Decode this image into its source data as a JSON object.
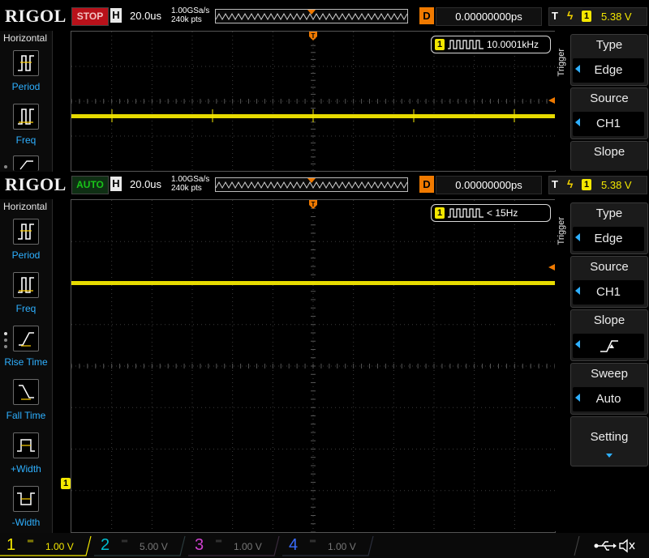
{
  "screens": [
    {
      "id": "top",
      "brand": "RIGOL",
      "run_state": "STOP",
      "timebase_label": "H",
      "timebase_value": "20.0us",
      "sample_rate": "1.00GSa/s",
      "memory_depth": "240k pts",
      "delay_label": "D",
      "delay_value": "0.00000000ps",
      "trigger_label": "T",
      "trigger_channel": "1",
      "trigger_level": "5.38 V",
      "freq_channel": "1",
      "freq_value": "10.0001kHz",
      "menu_heading": "Horizontal",
      "left_buttons": [
        {
          "label": "Period",
          "icon": "period-icon"
        },
        {
          "label": "Freq",
          "icon": "freq-icon"
        }
      ],
      "right_caption": "Trigger",
      "right_buttons": [
        {
          "title": "Type",
          "value": "Edge"
        },
        {
          "title": "Source",
          "value": "CH1"
        },
        {
          "title": "Slope",
          "value": ""
        }
      ]
    },
    {
      "id": "bottom",
      "brand": "RIGOL",
      "run_state": "AUTO",
      "timebase_label": "H",
      "timebase_value": "20.0us",
      "sample_rate": "1.00GSa/s",
      "memory_depth": "240k pts",
      "delay_label": "D",
      "delay_value": "0.00000000ps",
      "trigger_label": "T",
      "trigger_channel": "1",
      "trigger_level": "5.38 V",
      "freq_channel": "1",
      "freq_value": "< 15Hz",
      "menu_heading": "Horizontal",
      "left_buttons": [
        {
          "label": "Period",
          "icon": "period-icon"
        },
        {
          "label": "Freq",
          "icon": "freq-icon"
        },
        {
          "label": "Rise Time",
          "icon": "rise-time-icon"
        },
        {
          "label": "Fall Time",
          "icon": "fall-time-icon"
        },
        {
          "label": "+Width",
          "icon": "positive-width-icon"
        },
        {
          "label": "-Width",
          "icon": "negative-width-icon"
        }
      ],
      "right_caption": "Trigger",
      "right_buttons": [
        {
          "title": "Type",
          "value": "Edge"
        },
        {
          "title": "Source",
          "value": "CH1"
        },
        {
          "title": "Slope",
          "value": "",
          "icon": "rising-edge-icon"
        },
        {
          "title": "Sweep",
          "value": "Auto"
        },
        {
          "title": "Setting",
          "icon": "chevron-down-icon"
        }
      ],
      "ground_marker": "1"
    }
  ],
  "channels": [
    {
      "num": "1",
      "scale": "1.00 V",
      "color": "#f3e700",
      "active": true
    },
    {
      "num": "2",
      "scale": "5.00 V",
      "color": "#00bdd0",
      "active": false
    },
    {
      "num": "3",
      "scale": "1.00 V",
      "color": "#d040d0",
      "active": false
    },
    {
      "num": "4",
      "scale": "1.00 V",
      "color": "#3a6cff",
      "active": false
    }
  ],
  "colors": {
    "trace": "#f3e700",
    "accent": "#2eb0ff",
    "stop": "#b8111a",
    "auto": "#19c419",
    "delay": "#f07a00"
  },
  "status_icons": [
    "usb-icon",
    "speaker-muted-icon"
  ]
}
